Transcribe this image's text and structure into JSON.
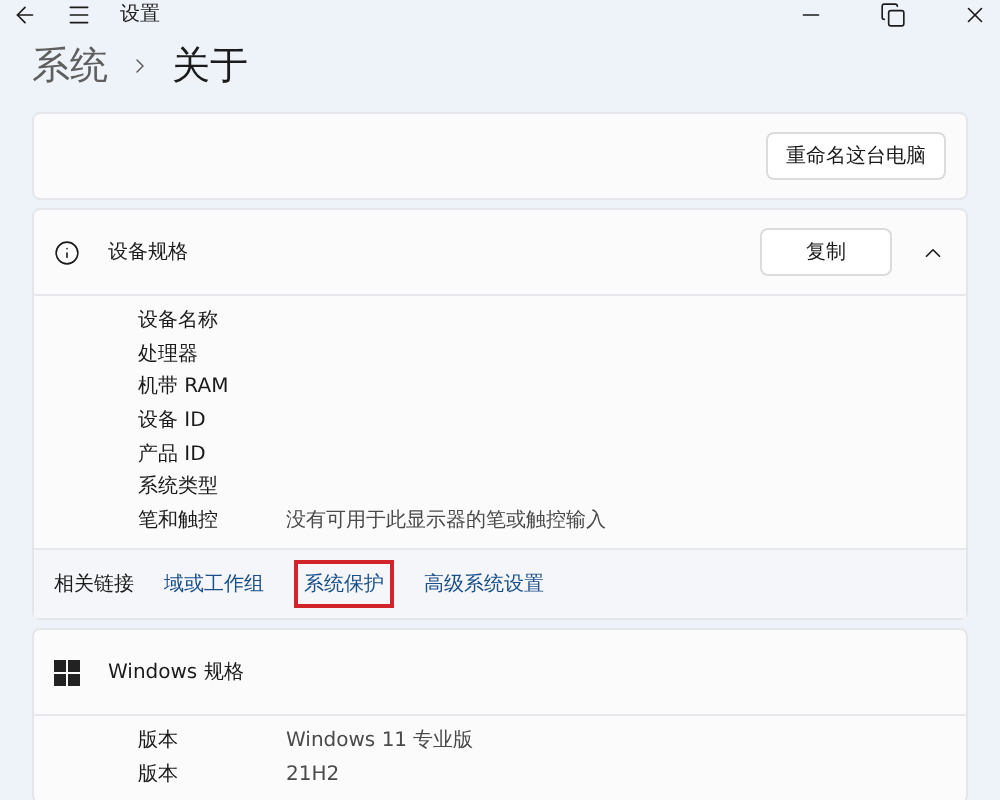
{
  "window": {
    "title": "设置"
  },
  "breadcrumb": {
    "parent": "系统",
    "current": "关于"
  },
  "device_card": {
    "rename_button": "重命名这台电脑"
  },
  "device_specs": {
    "title": "设备规格",
    "copy_button": "复制",
    "expanded": true,
    "rows": [
      {
        "label": "设备名称"
      },
      {
        "label": "处理器"
      },
      {
        "label": "机带 RAM"
      },
      {
        "label": "设备 ID"
      },
      {
        "label": "产品 ID"
      },
      {
        "label": "系统类型"
      },
      {
        "label": "笔和触控",
        "value": "没有可用于此显示器的笔或触控输入"
      }
    ]
  },
  "related_links": {
    "label": "相关链接",
    "links": [
      {
        "text": "域或工作组",
        "highlighted": false
      },
      {
        "text": "系统保护",
        "highlighted": true
      },
      {
        "text": "高级系统设置",
        "highlighted": false
      }
    ]
  },
  "windows_specs": {
    "title": "Windows 规格",
    "rows": [
      {
        "label": "版本",
        "value": "Windows 11 专业版"
      },
      {
        "label": "版本",
        "value": "21H2"
      }
    ]
  }
}
